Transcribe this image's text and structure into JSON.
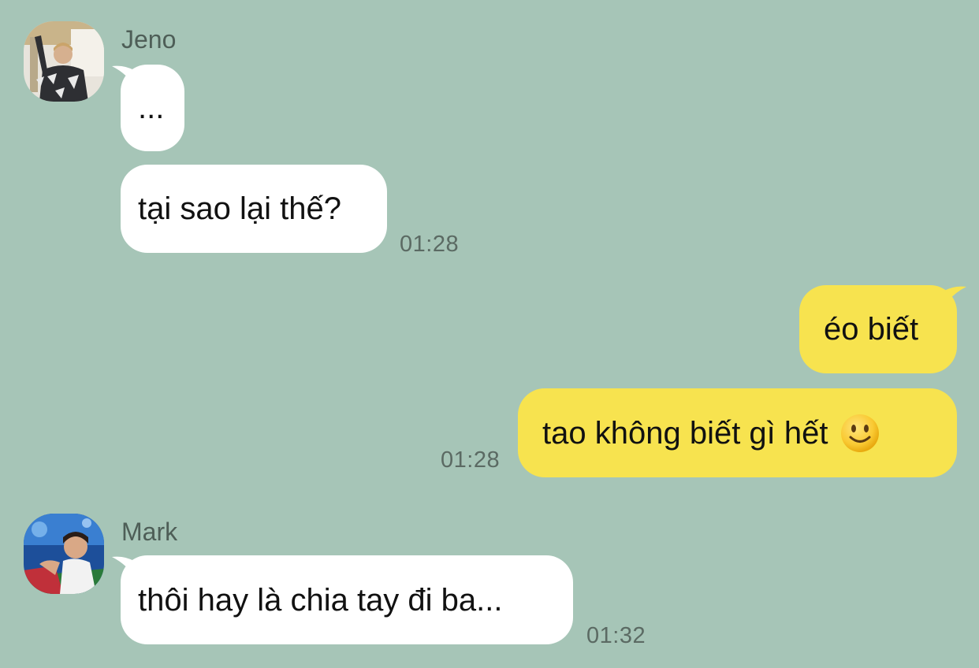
{
  "theme": {
    "background": "#a6c5b7",
    "incoming_bubble": "#ffffff",
    "outgoing_bubble": "#f7e34f",
    "text": "#111111",
    "meta_text": "#5b6a63"
  },
  "messages": [
    {
      "sender": "Jeno",
      "direction": "incoming",
      "avatar": "avatar-photo",
      "text": "...",
      "time": ""
    },
    {
      "sender": "Jeno",
      "direction": "incoming",
      "text": "tại sao lại thế?",
      "time": "01:28"
    },
    {
      "sender": "me",
      "direction": "outgoing",
      "text": "éo biết",
      "time": ""
    },
    {
      "sender": "me",
      "direction": "outgoing",
      "text": "tao không biết gì hết",
      "emoji": "slightly-smiling-face-icon",
      "time": "01:28"
    },
    {
      "sender": "Mark",
      "direction": "incoming",
      "avatar": "avatar-photo",
      "text": "thôi hay là chia tay đi ba...",
      "time": "01:32"
    }
  ]
}
